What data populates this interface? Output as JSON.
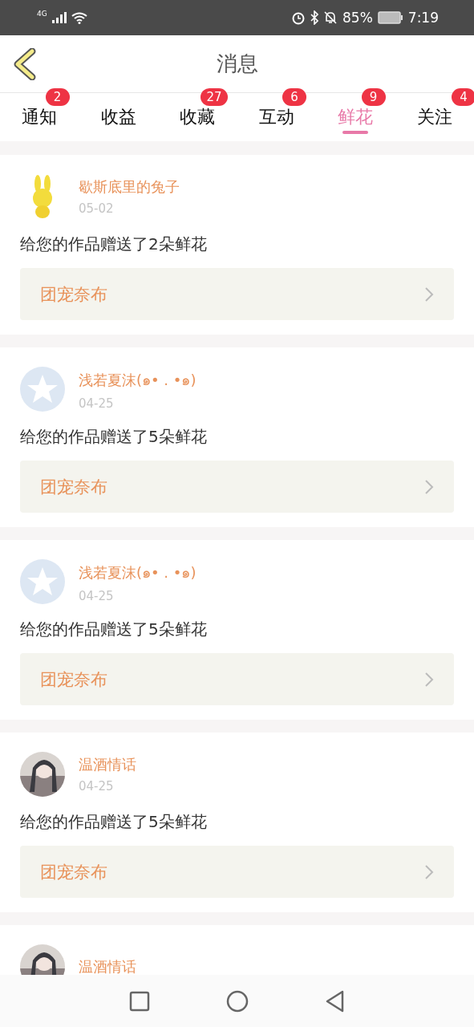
{
  "status_bar": {
    "network": "4G",
    "battery": "85%",
    "time": "7:19"
  },
  "header": {
    "title": "消息"
  },
  "tabs": [
    {
      "label": "通知",
      "badge": "2",
      "selected": false
    },
    {
      "label": "收益",
      "selected": false
    },
    {
      "label": "收藏",
      "badge": "27",
      "selected": false
    },
    {
      "label": "互动",
      "badge": "6",
      "selected": false
    },
    {
      "label": "鲜花",
      "badge": "9",
      "selected": true
    },
    {
      "label": "关注",
      "badge": "4",
      "selected": false
    }
  ],
  "messages": [
    {
      "avatar": {
        "kind": "cartoon"
      },
      "name": "歇斯底里的兔子",
      "date": "05-02",
      "text": "给您的作品赠送了2朵鲜花",
      "work": "团宠奈布"
    },
    {
      "avatar": {
        "kind": "default"
      },
      "name": "浅若夏沫(๑• . •๑)",
      "date": "04-25",
      "text": "给您的作品赠送了5朵鲜花",
      "work": "团宠奈布"
    },
    {
      "avatar": {
        "kind": "default"
      },
      "name": "浅若夏沫(๑• . •๑)",
      "date": "04-25",
      "text": "给您的作品赠送了5朵鲜花",
      "work": "团宠奈布"
    },
    {
      "name": "温酒情话",
      "date": "04-25",
      "text": "给您的作品赠送了5朵鲜花",
      "work": "团宠奈布"
    },
    {
      "name": "温酒情话"
    }
  ]
}
